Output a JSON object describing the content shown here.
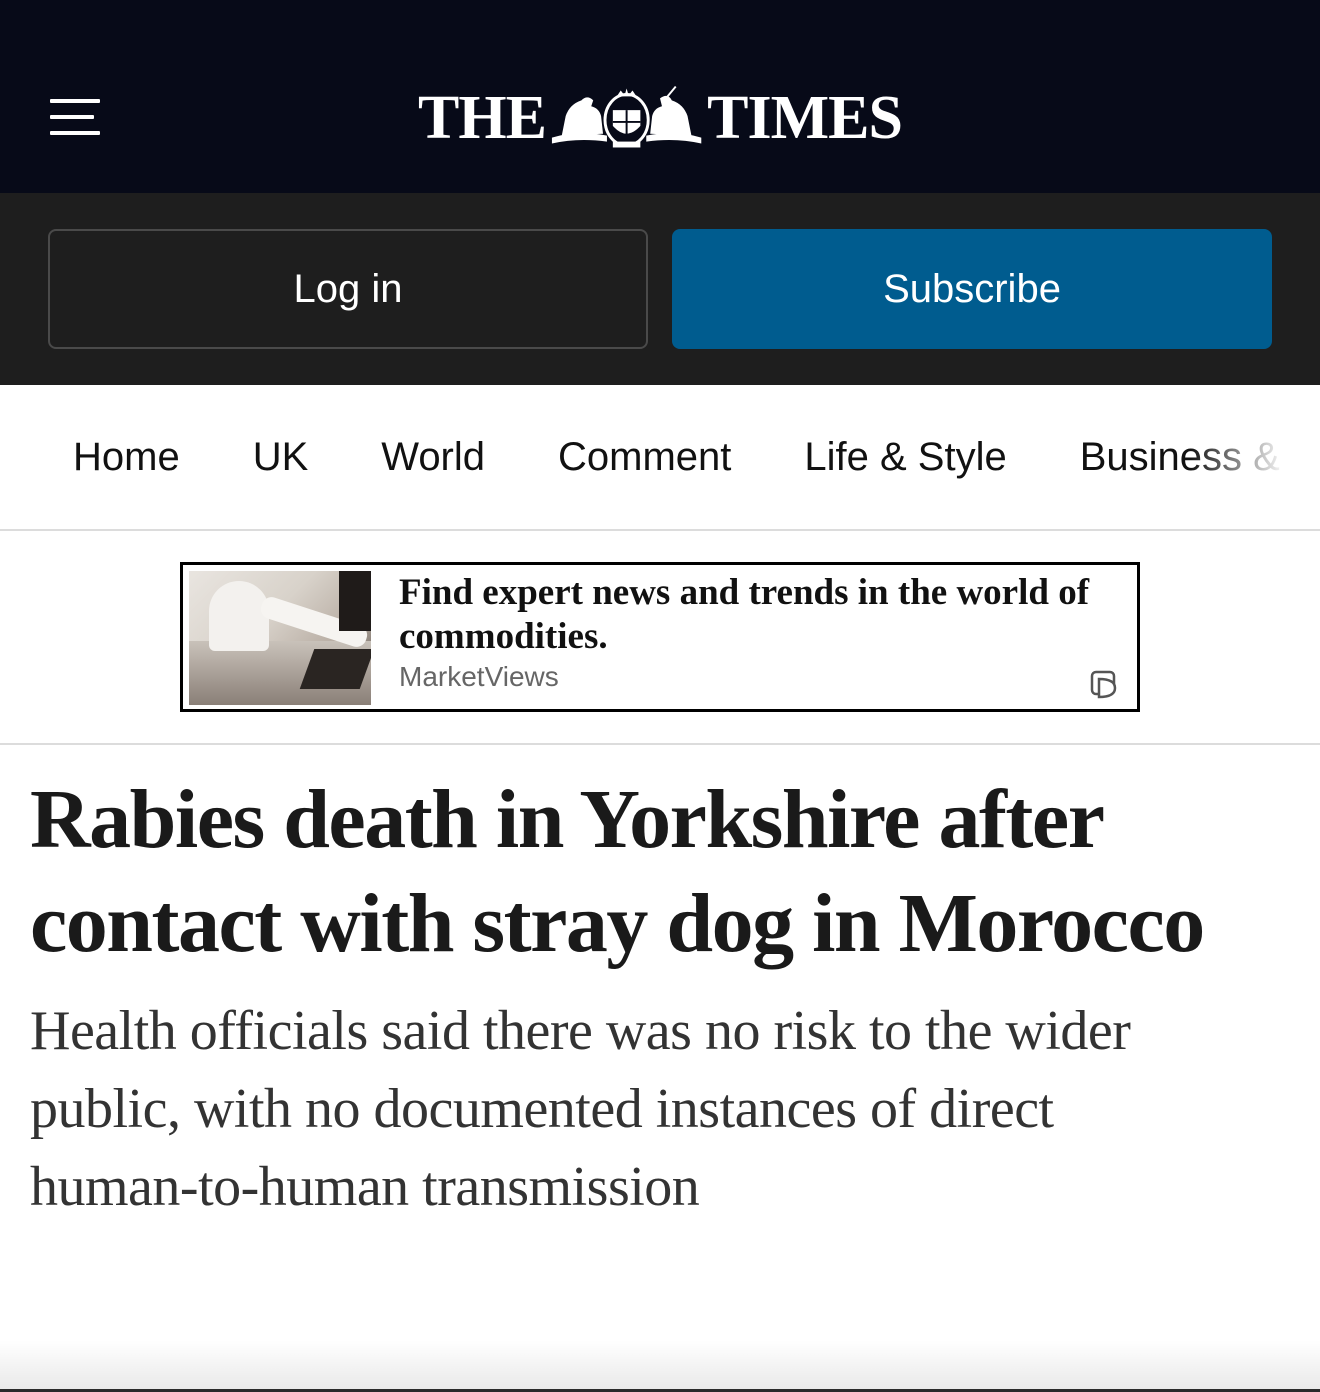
{
  "masthead": {
    "logo_left": "THE",
    "logo_right": "TIMES",
    "crest_icon": "royal-crest-icon",
    "menu_icon": "hamburger-menu-icon",
    "background": "#070a18"
  },
  "auth": {
    "login_label": "Log in",
    "subscribe_label": "Subscribe",
    "subscribe_color": "#005c8f"
  },
  "nav": {
    "items": [
      {
        "label": "Home"
      },
      {
        "label": "UK"
      },
      {
        "label": "World"
      },
      {
        "label": "Comment"
      },
      {
        "label": "Life & Style"
      },
      {
        "label": "Business &"
      }
    ]
  },
  "ad": {
    "title": "Find expert news and trends in the world of commodities.",
    "source": "MarketViews",
    "choice_icon": "adchoices-icon"
  },
  "article": {
    "headline": "Rabies death in Yorkshire after contact with stray dog in Morocco",
    "standfirst": "Health officials said there was no risk to the wider public, with no documented instances of direct human-to-human transmission"
  }
}
